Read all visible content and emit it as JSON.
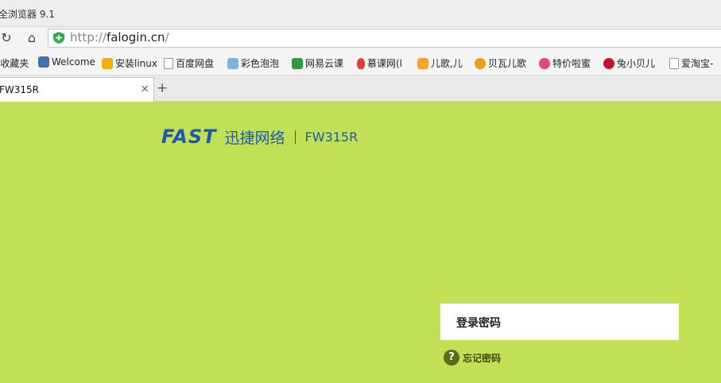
{
  "window": {
    "title": "全浏览器 9.1"
  },
  "address_bar": {
    "scheme": "http://",
    "host": "falogin.cn",
    "path": "/",
    "refresh_icon": "refresh-icon",
    "home_icon": "home-icon",
    "security_icon": "shield-icon"
  },
  "bookmarks": [
    {
      "label": "l收藏夹",
      "icon": "folder-icon",
      "color": "#f4f4f4"
    },
    {
      "label": "Welcome",
      "icon": "python-icon",
      "color": "#3b73b3"
    },
    {
      "label": "安装linux",
      "icon": "trophy-icon",
      "color": "#f2b100"
    },
    {
      "label": "百度网盘",
      "icon": "page-icon",
      "color": "#ffffff"
    },
    {
      "label": "彩色泡泡",
      "icon": "image-icon",
      "color": "#79b4e6"
    },
    {
      "label": "网易云课",
      "icon": "book-icon",
      "color": "#2e9c3b"
    },
    {
      "label": "慕课网(l",
      "icon": "flame-icon",
      "color": "#e0422b"
    },
    {
      "label": "儿歌,儿",
      "icon": "music-icon",
      "color": "#f6a623"
    },
    {
      "label": "贝瓦儿歌",
      "icon": "face-icon",
      "color": "#f39c12"
    },
    {
      "label": "特价啦蜜",
      "icon": "pig-icon",
      "color": "#e8457a"
    },
    {
      "label": "兔小贝儿",
      "icon": "play-icon",
      "color": "#c8102e"
    },
    {
      "label": "爱淘宝-",
      "icon": "page-icon",
      "color": "#ffffff"
    }
  ],
  "tabs": [
    {
      "label": "FW315R",
      "close": "×"
    }
  ],
  "new_tab": "+",
  "page": {
    "brand": "FAST",
    "brand_cn": "迅捷网络",
    "model": "FW315R",
    "password_placeholder": "登录密码",
    "forgot_icon": "?",
    "forgot_label": "忘记密码",
    "brand_color": "#1f57b3",
    "background_color": "#c2e055"
  }
}
